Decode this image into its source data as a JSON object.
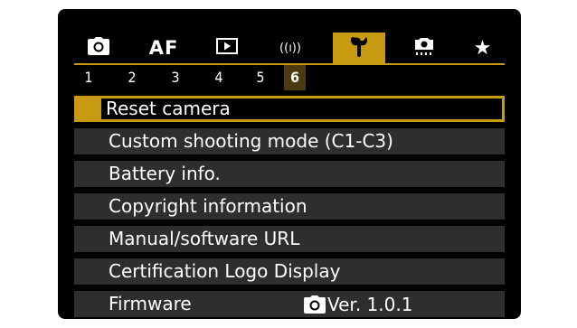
{
  "tabs": [
    {
      "id": "shooting",
      "icon": "camera-icon",
      "label": "",
      "active": false
    },
    {
      "id": "af",
      "icon": "",
      "label": "AF",
      "active": false
    },
    {
      "id": "playback",
      "icon": "playback-icon",
      "label": "",
      "active": false
    },
    {
      "id": "wireless",
      "icon": "",
      "label": "((ı))",
      "active": false
    },
    {
      "id": "setup",
      "icon": "wrench-icon",
      "label": "",
      "active": true
    },
    {
      "id": "custom",
      "icon": "custom-functions-icon",
      "label": "",
      "active": false
    },
    {
      "id": "mymenu",
      "icon": "star-icon",
      "label": "★",
      "active": false
    }
  ],
  "pages": [
    "1",
    "2",
    "3",
    "4",
    "5",
    "6"
  ],
  "active_page": "6",
  "menu": {
    "items": [
      {
        "label": "Reset camera",
        "selected": true
      },
      {
        "label": "Custom shooting mode (C1-C3)",
        "selected": false
      },
      {
        "label": "Battery info.",
        "selected": false
      },
      {
        "label": "Copyright information",
        "selected": false
      },
      {
        "label": "Manual/software URL",
        "selected": false
      },
      {
        "label": "Certification Logo Display",
        "selected": false
      },
      {
        "label": "Firmware",
        "selected": false,
        "value": "Ver. 1.0.1",
        "value_icon": "camera-icon"
      }
    ]
  },
  "colors": {
    "accent": "#c79a12",
    "background": "#000000",
    "item_background": "#2e2e2e",
    "text": "#ffffff"
  }
}
